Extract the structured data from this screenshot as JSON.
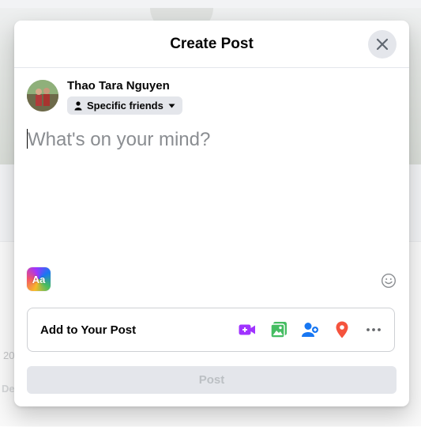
{
  "background": {
    "fragments": [
      "20",
      "De"
    ]
  },
  "modal": {
    "title": "Create Post",
    "close_icon": "close-icon"
  },
  "user": {
    "name": "Thao Tara Nguyen",
    "audience": "Specific friends"
  },
  "composer": {
    "placeholder": "What's on your mind?",
    "value": ""
  },
  "text_format": {
    "label": "Aa"
  },
  "add_to_post": {
    "label": "Add to Your Post",
    "icons": [
      "live-video-icon",
      "photo-video-icon",
      "tag-people-icon",
      "check-in-icon",
      "more-icon"
    ]
  },
  "post_button": {
    "label": "Post",
    "enabled": false
  },
  "colors": {
    "video": "#a033ff",
    "photo": "#45bd62",
    "tag": "#1877f2",
    "checkin": "#f5533d",
    "more": "#65676b"
  }
}
